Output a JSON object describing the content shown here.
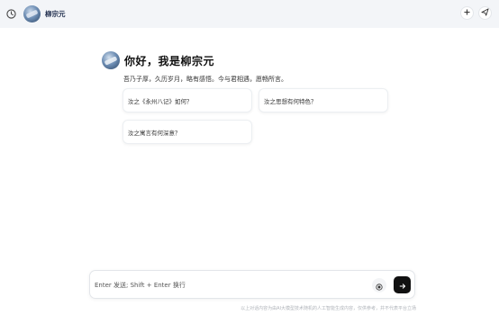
{
  "header": {
    "title": "柳宗元",
    "history_icon": "clock-icon",
    "add_icon": "plus-icon",
    "share_icon": "send-icon"
  },
  "hero": {
    "title": "你好，我是柳宗元",
    "subtitle": "吾乃子厚，久历岁月，略有感悟。今与君相遇，愿畅所言。"
  },
  "suggestions": [
    {
      "label": "汝之《永州八记》如何？"
    },
    {
      "label": "汝之思想有何特色？"
    },
    {
      "label": "汝之寓言有何深意？"
    }
  ],
  "composer": {
    "placeholder": "Enter 发送; Shift + Enter 换行"
  },
  "footer": {
    "note": "以上对话内容为由AI大模型技术随机的人工智能生成内容，仅供参考，并不代表平台立场"
  }
}
